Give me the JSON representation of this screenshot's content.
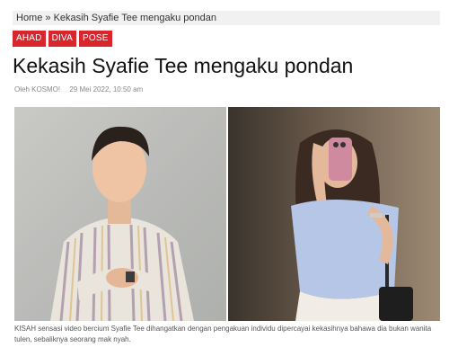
{
  "breadcrumb": {
    "home": "Home",
    "separator": " » ",
    "current": "Kekasih Syafie Tee mengaku pondan"
  },
  "tags": [
    "AHAD",
    "DIVA",
    "POSE"
  ],
  "article": {
    "title": "Kekasih Syafie Tee mengaku pondan",
    "author": "Oleh KOSMO!",
    "date": "29 Mei 2022, 10:50 am",
    "caption": "KISAH sensasi video bercium Syafie Tee dihangatkan dengan pengakuan individu dipercayai kekasihnya bahawa dia bukan wanita tulen, sebaliknya seorang mak nyah."
  },
  "colors": {
    "tag_bg": "#d9262c",
    "breadcrumb_bg": "#f1f1f1"
  }
}
